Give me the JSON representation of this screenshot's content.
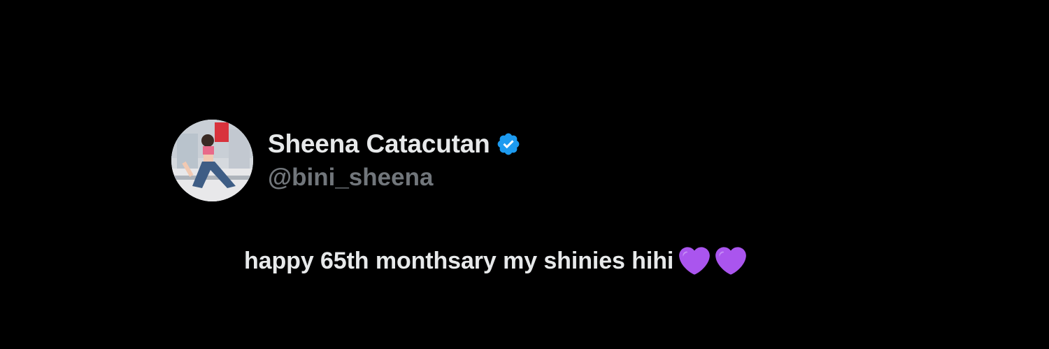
{
  "tweet": {
    "author": {
      "display_name": "Sheena Catacutan",
      "handle": "@bini_sheena",
      "verified": true,
      "avatar": "profile-photo-avatar"
    },
    "text": "happy 65th monthsary my shinies hihi",
    "emojis": [
      "purple-heart-icon",
      "purple-heart-icon"
    ]
  },
  "colors": {
    "background": "#000000",
    "primary_text": "#e7e9ea",
    "secondary_text": "#71767b",
    "verified_badge": "#1d9bf0",
    "heart": "#a855f7"
  }
}
